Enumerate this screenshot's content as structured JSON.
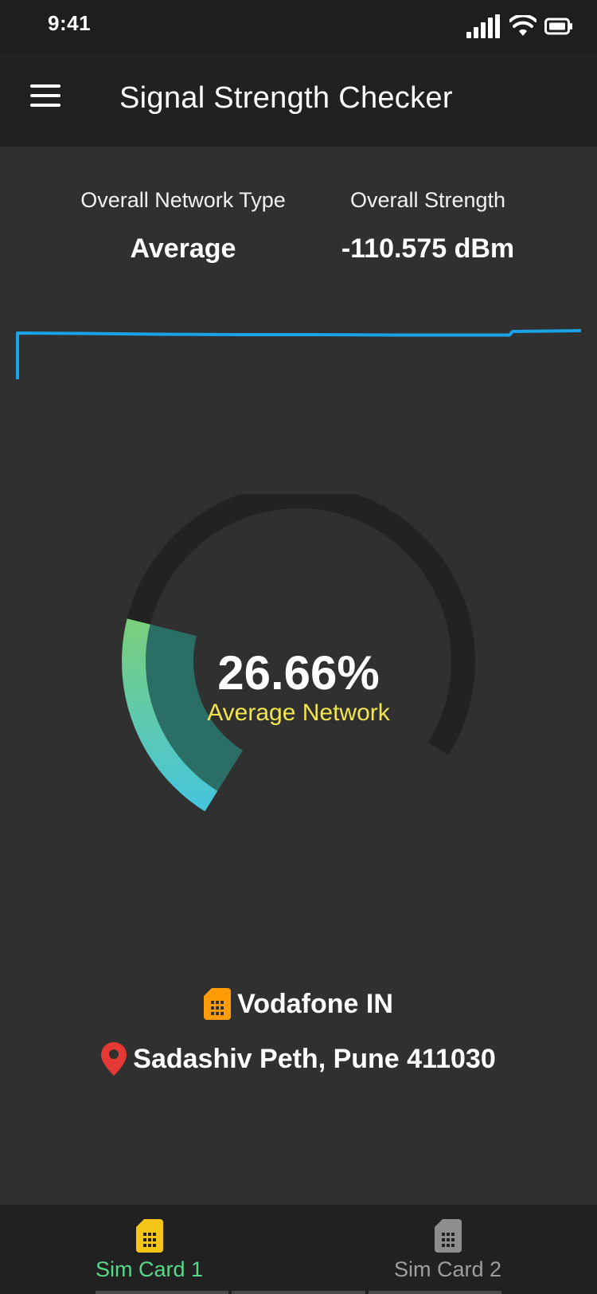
{
  "status_bar": {
    "time": "9:41"
  },
  "app_bar": {
    "title": "Signal Strength Checker"
  },
  "summary": {
    "type_label": "Overall Network Type",
    "type_value": "Average",
    "strength_label": "Overall Strength",
    "strength_value": "-110.575 dBm"
  },
  "gauge": {
    "percent_text": "26.66%",
    "percent": 26.66,
    "label": "Average Network"
  },
  "info": {
    "carrier": "Vodafone IN",
    "location": "Sadashiv Peth, Pune 411030"
  },
  "bottom_nav": {
    "items": [
      {
        "label": "Sim Card 1",
        "active": true
      },
      {
        "label": "Sim Card 2",
        "active": false
      }
    ]
  },
  "colors": {
    "background": "#303030",
    "bar": "#212121",
    "graph_line": "#1aa3e6",
    "gauge_track": "#222222",
    "gauge_green": "#7ccf7a",
    "gauge_cyan": "#44c5df",
    "gauge_teal": "#2a6e66",
    "status_label": "#f2e64a",
    "sim_orange": "#ff9c07",
    "sim_yellow": "#f5c518",
    "pin_red": "#e53935",
    "active_tab": "#57d98a",
    "inactive_tab": "#9e9e9e"
  },
  "icons": [
    "menu-icon",
    "signal-icon",
    "wifi-icon",
    "battery-icon",
    "sim-card-icon",
    "location-pin-icon"
  ]
}
